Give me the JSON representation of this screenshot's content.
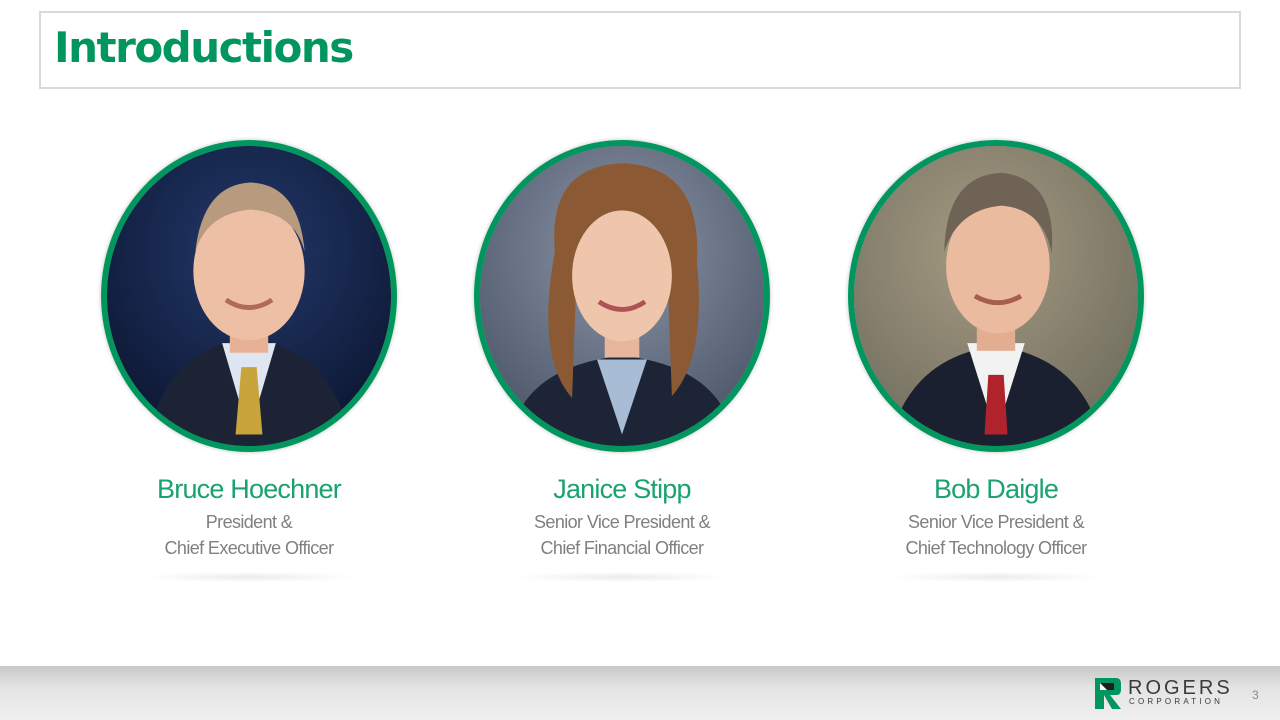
{
  "slide": {
    "title": "Introductions",
    "page_number": "3"
  },
  "people": [
    {
      "name": "Bruce Hoechner",
      "role_line1": "President &",
      "role_line2": "Chief Executive Officer"
    },
    {
      "name": "Janice Stipp",
      "role_line1": "Senior Vice President &",
      "role_line2": "Chief Financial Officer"
    },
    {
      "name": "Bob Daigle",
      "role_line1": "Senior Vice President &",
      "role_line2": "Chief Technology Officer"
    }
  ],
  "logo": {
    "wordmark": "ROGERS",
    "subtitle": "CORPORATION",
    "icon": "rogers-logo-icon"
  },
  "colors": {
    "accent": "#00965e",
    "name_text": "#1aa26f",
    "role_text": "#808080"
  }
}
